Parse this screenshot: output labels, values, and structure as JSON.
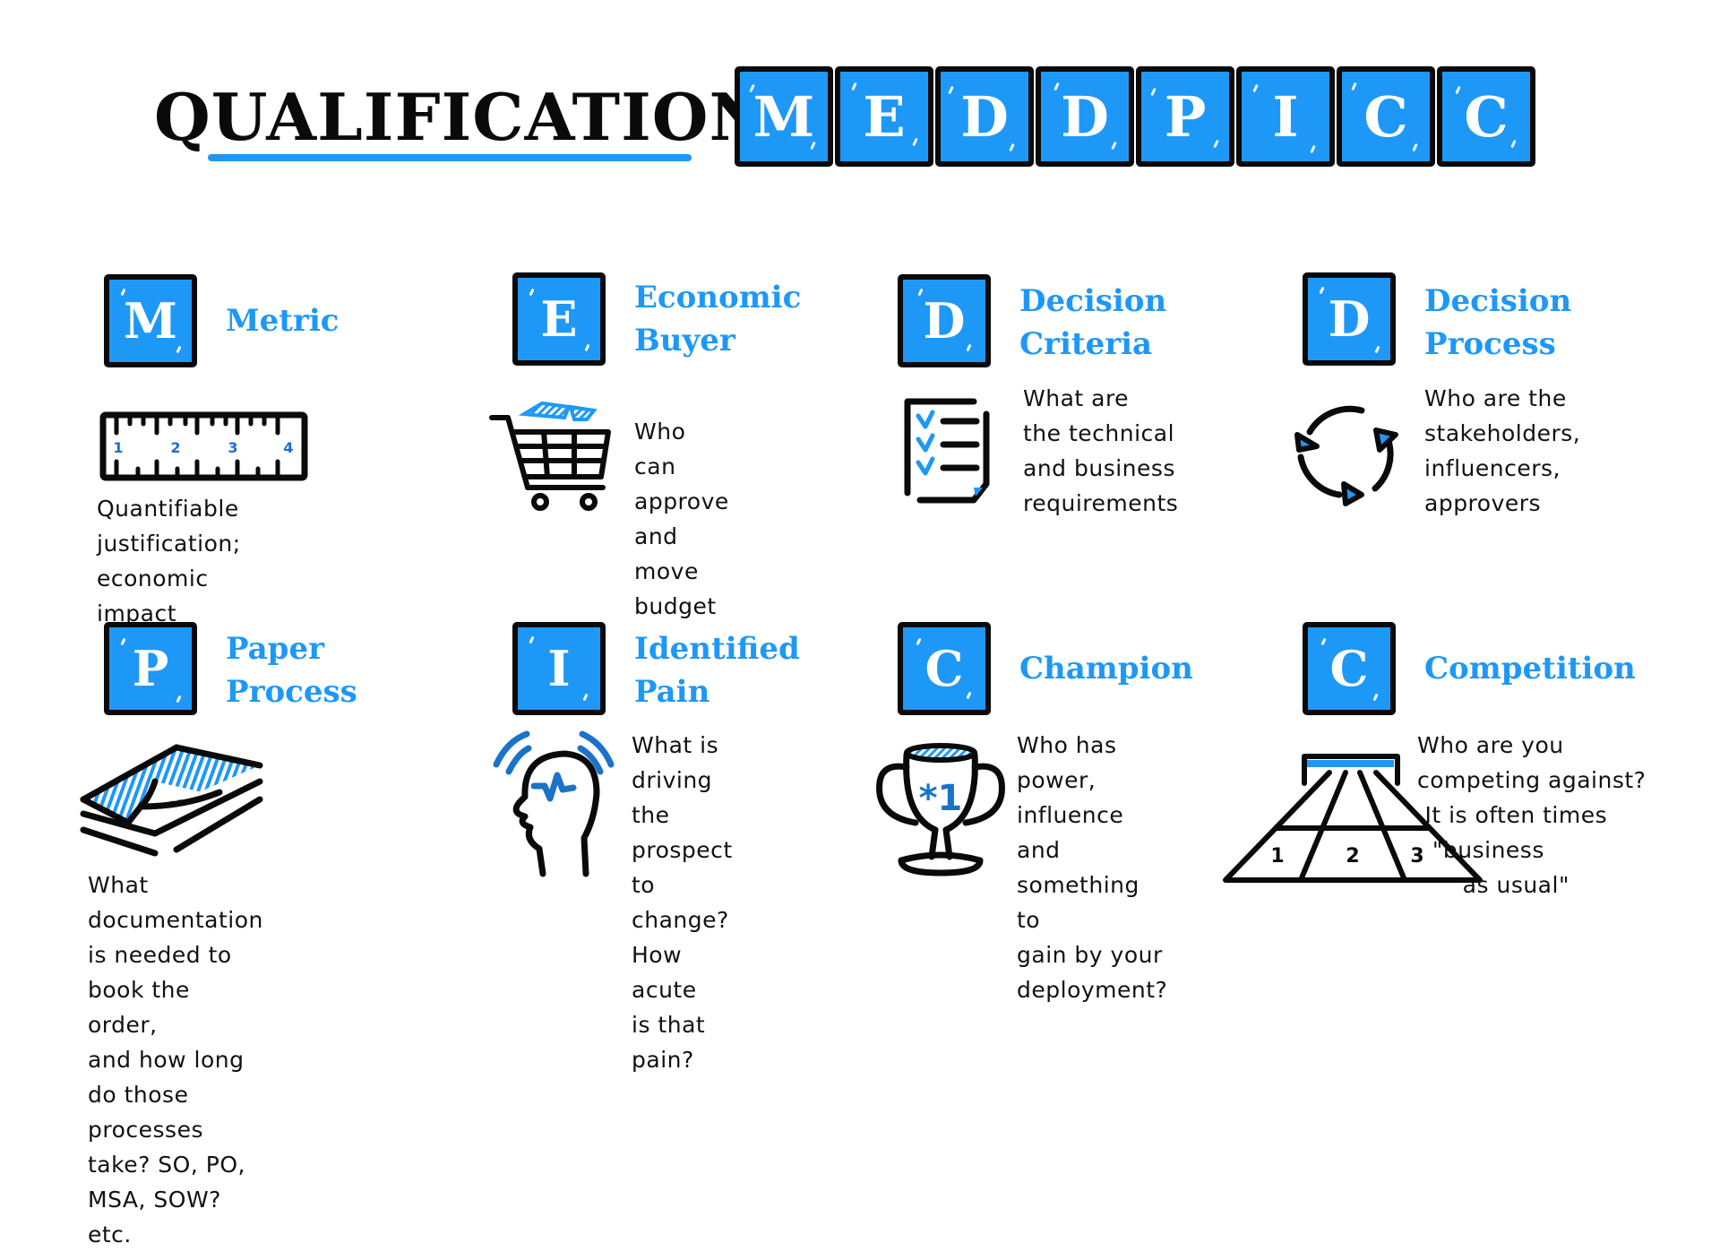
{
  "header": {
    "title": "QUALIFICATION",
    "acronym_letters": [
      "M",
      "E",
      "D",
      "D",
      "P",
      "I",
      "C",
      "C"
    ]
  },
  "colors": {
    "accent": "#1e98f7",
    "ink": "#0a0a0a",
    "background": "#ffffff"
  },
  "cards": [
    {
      "letter": "M",
      "heading": "Metric",
      "icon": "ruler-icon",
      "description": "Quantifiable justification;\neconomic impact",
      "ruler_numbers": [
        "1",
        "2",
        "3",
        "4"
      ]
    },
    {
      "letter": "E",
      "heading": "Economic\nBuyer",
      "icon": "shopping-cart-icon",
      "description": "Who can approve\nand move budget"
    },
    {
      "letter": "D",
      "heading": "Decision\nCriteria",
      "icon": "checklist-icon",
      "description": "What are\nthe technical\nand business\nrequirements"
    },
    {
      "letter": "D",
      "heading": "Decision\nProcess",
      "icon": "cycle-arrows-icon",
      "description": "Who are the\nstakeholders,\ninfluencers,\napprovers"
    },
    {
      "letter": "P",
      "heading": "Paper\nProcess",
      "icon": "paper-stack-icon",
      "description": "What documentation\nis needed to book the order,\nand how long do those processes\ntake? SO, PO, MSA, SOW? etc."
    },
    {
      "letter": "I",
      "heading": "Identified\nPain",
      "icon": "head-pain-icon",
      "description": "What is driving\nthe prospect\nto change?\nHow acute\nis that pain?"
    },
    {
      "letter": "C",
      "heading": "Champion",
      "icon": "trophy-icon",
      "description": "Who has power,\ninfluence and\nsomething to\ngain by your\ndeployment?",
      "trophy_label": "*1"
    },
    {
      "letter": "C",
      "heading": "Competition",
      "icon": "race-track-icon",
      "description": "Who are you\ncompeting against?\n It is often times\n  \"business\n      as usual\"",
      "lane_numbers": [
        "1",
        "2",
        "3"
      ]
    }
  ]
}
